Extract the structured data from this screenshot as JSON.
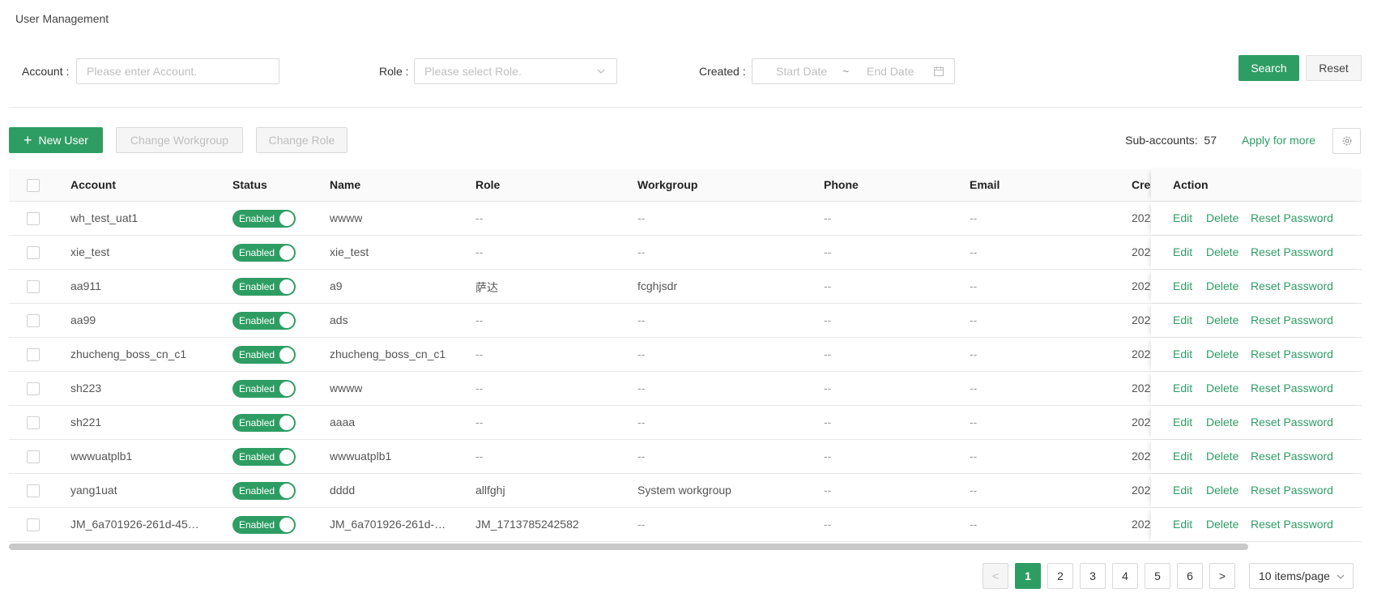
{
  "page": {
    "title": "User Management"
  },
  "filters": {
    "account_label": "Account",
    "account_placeholder": "Please enter Account.",
    "role_label": "Role",
    "role_placeholder": "Please select Role.",
    "created_label": "Created",
    "start_placeholder": "Start Date",
    "range_sep": "~",
    "end_placeholder": "End Date",
    "search_label": "Search",
    "reset_label": "Reset"
  },
  "toolbar": {
    "new_user_icon": "+",
    "new_user_label": "New User",
    "change_workgroup_label": "Change Workgroup",
    "change_role_label": "Change Role",
    "subaccounts_label": "Sub-accounts",
    "subaccounts_count": "57",
    "apply_label": "Apply for more"
  },
  "table": {
    "columns": {
      "account": "Account",
      "status": "Status",
      "name": "Name",
      "role": "Role",
      "workgroup": "Workgroup",
      "phone": "Phone",
      "email": "Email",
      "created": "Created",
      "action": "Action"
    },
    "rows": [
      {
        "account": "wh_test_uat1",
        "status": "Enabled",
        "name": "wwww",
        "role": "--",
        "workgroup": "--",
        "phone": "--",
        "email": "--",
        "created": "202"
      },
      {
        "account": "xie_test",
        "status": "Enabled",
        "name": "xie_test",
        "role": "--",
        "workgroup": "--",
        "phone": "--",
        "email": "--",
        "created": "202"
      },
      {
        "account": "aa911",
        "status": "Enabled",
        "name": "a9",
        "role": "萨达",
        "workgroup": "fcghjsdr",
        "phone": "--",
        "email": "--",
        "created": "202"
      },
      {
        "account": "aa99",
        "status": "Enabled",
        "name": "ads",
        "role": "--",
        "workgroup": "--",
        "phone": "--",
        "email": "--",
        "created": "202"
      },
      {
        "account": "zhucheng_boss_cn_c1",
        "status": "Enabled",
        "name": "zhucheng_boss_cn_c1",
        "role": "--",
        "workgroup": "--",
        "phone": "--",
        "email": "--",
        "created": "202"
      },
      {
        "account": "sh223",
        "status": "Enabled",
        "name": "wwww",
        "role": "--",
        "workgroup": "--",
        "phone": "--",
        "email": "--",
        "created": "202"
      },
      {
        "account": "sh221",
        "status": "Enabled",
        "name": "aaaa",
        "role": "--",
        "workgroup": "--",
        "phone": "--",
        "email": "--",
        "created": "202"
      },
      {
        "account": "wwwuatplb1",
        "status": "Enabled",
        "name": "wwwuatplb1",
        "role": "--",
        "workgroup": "--",
        "phone": "--",
        "email": "--",
        "created": "202"
      },
      {
        "account": "yang1uat",
        "status": "Enabled",
        "name": "dddd",
        "role": "allfghj",
        "workgroup": "System workgroup",
        "phone": "--",
        "email": "--",
        "created": "202"
      },
      {
        "account": "JM_6a701926-261d-45…",
        "status": "Enabled",
        "name": "JM_6a701926-261d-…",
        "role": "JM_1713785242582",
        "workgroup": "--",
        "phone": "--",
        "email": "--",
        "created": "202"
      }
    ],
    "actions": {
      "edit": "Edit",
      "delete": "Delete",
      "reset_password": "Reset Password"
    }
  },
  "pagination": {
    "prev": "<",
    "pages": [
      "1",
      "2",
      "3",
      "4",
      "5",
      "6"
    ],
    "current": "1",
    "next": ">",
    "page_size": "10 items/page"
  },
  "colors": {
    "primary": "#2e9d64",
    "border": "#d9d9d9",
    "header_bg": "#fafafa"
  },
  "icons": [
    "chevron-down-icon",
    "calendar-icon",
    "plus-icon",
    "gear-icon",
    "chevron-left-icon",
    "chevron-right-icon"
  ]
}
